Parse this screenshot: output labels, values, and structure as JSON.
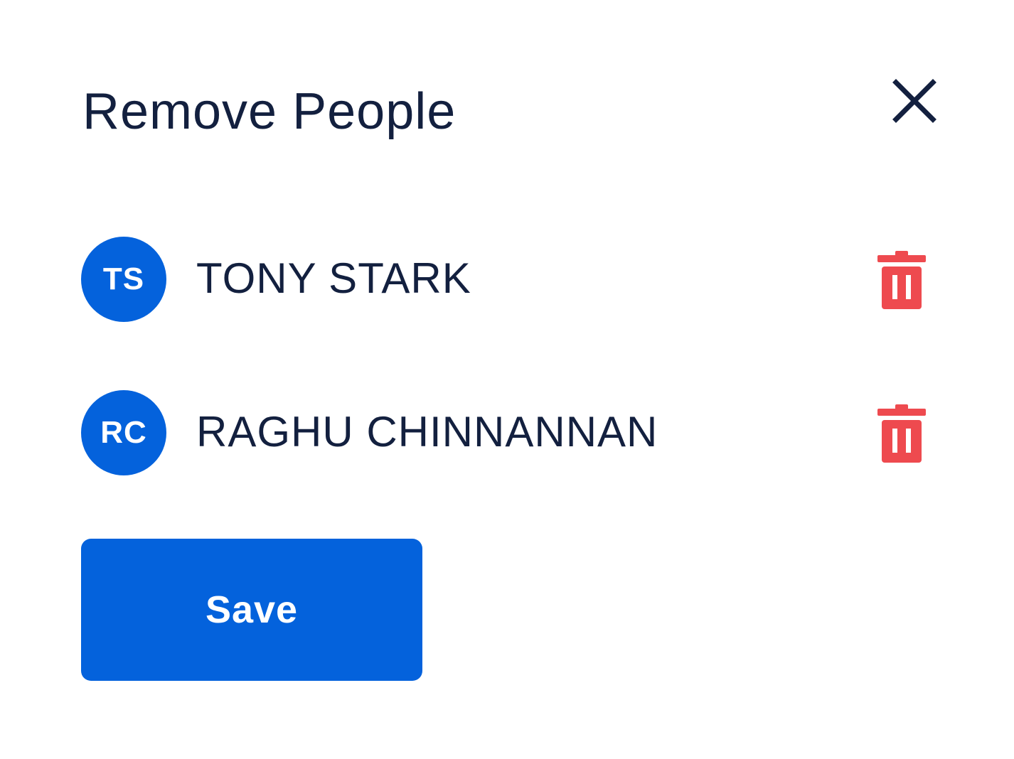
{
  "dialog": {
    "title": "Remove People",
    "close_icon": "close-icon",
    "people": [
      {
        "initials": "TS",
        "name": "TONY STARK",
        "delete_icon": "trash-icon"
      },
      {
        "initials": "RC",
        "name": "RAGHU CHINNANNAN",
        "delete_icon": "trash-icon"
      }
    ],
    "save_label": "Save"
  },
  "colors": {
    "primary": "#0462dc",
    "text": "#13203f",
    "danger": "#ee4a4f",
    "background": "#ffffff"
  }
}
